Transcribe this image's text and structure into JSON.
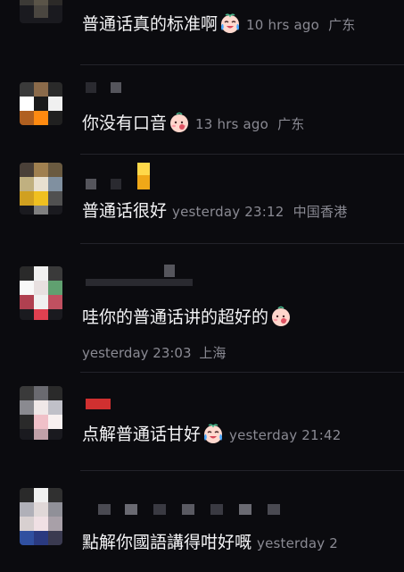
{
  "comments": [
    {
      "text": "普通话真的标准啊",
      "emoji": "laugh-cry-emoji",
      "time": "10 hrs ago",
      "location": "广东"
    },
    {
      "text": "你没有口音",
      "emoji": "shy-emoji",
      "time": "13 hrs ago",
      "location": "广东"
    },
    {
      "text": "普通话很好",
      "emoji": "",
      "time": "yesterday 23:12",
      "location": "中国香港"
    },
    {
      "text": "哇你的普通话讲的超好的",
      "emoji": "shy-emoji",
      "time": "yesterday 23:03",
      "location": "上海"
    },
    {
      "text": "点解普通话甘好",
      "emoji": "laugh-cry-emoji",
      "time": "yesterday 21:42",
      "location": ""
    },
    {
      "text": "點解你國語講得咁好嘅",
      "emoji": "",
      "time": "yesterday 2",
      "location": ""
    }
  ],
  "colors": {
    "background": "#0b0b0f",
    "text": "#f4f4f6",
    "meta": "#8a8a93"
  }
}
